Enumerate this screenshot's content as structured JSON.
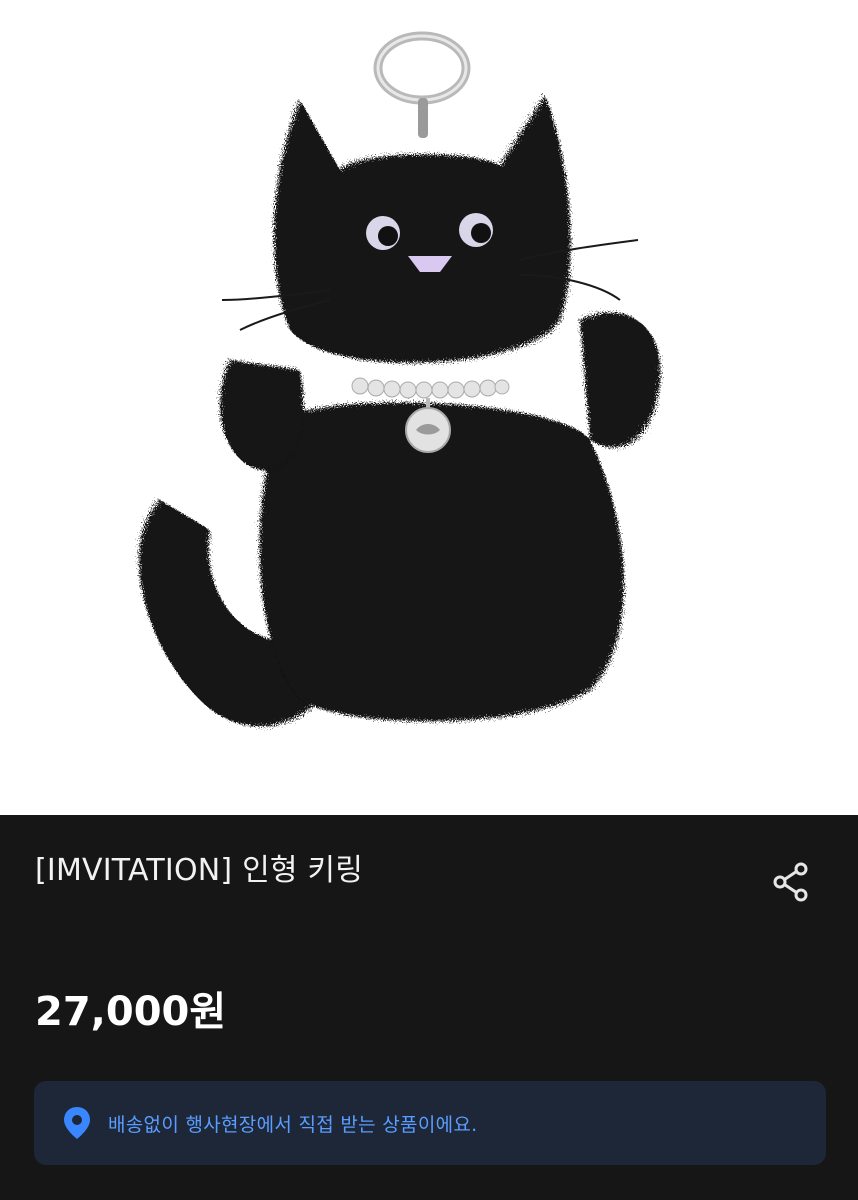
{
  "product": {
    "title": "[IMVITATION] 인형 키링",
    "price": "27,000원",
    "notice": "배송없이 행사현장에서 직접 받는 상품이에요.",
    "image_subject": "black fuzzy cat plush keyring with pearl collar"
  },
  "icons": {
    "share": "share-icon",
    "location": "location-pin-icon"
  },
  "colors": {
    "background": "#161617",
    "notice_bg": "#1d2738",
    "notice_text": "#5a9cff",
    "title_text": "#f2f2f2"
  }
}
